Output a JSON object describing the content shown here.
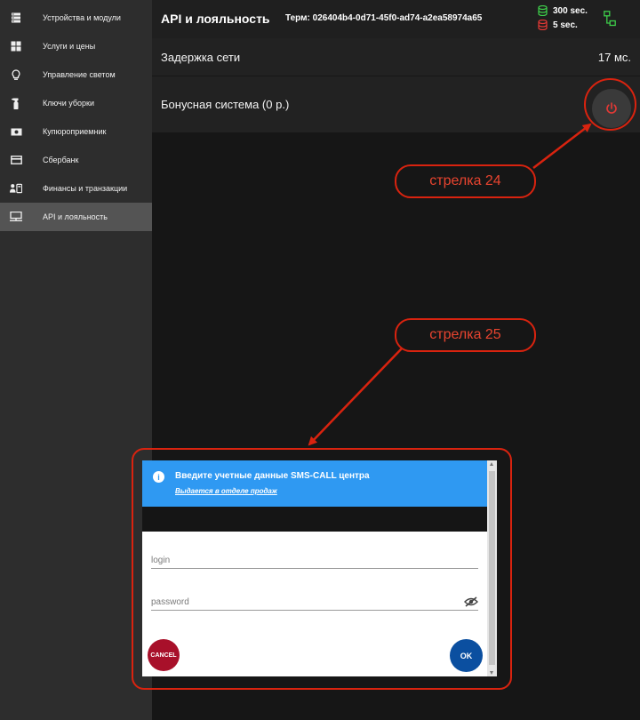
{
  "sidebar": {
    "items": [
      {
        "label": "Устройства и модули",
        "icon": "server-stack-icon"
      },
      {
        "label": "Услуги и цены",
        "icon": "grid-icon"
      },
      {
        "label": "Управление светом",
        "icon": "lightbulb-icon"
      },
      {
        "label": "Ключи уборки",
        "icon": "spray-bottle-icon"
      },
      {
        "label": "Купюроприемник",
        "icon": "banknote-icon"
      },
      {
        "label": "Сбербанк",
        "icon": "credit-card-icon"
      },
      {
        "label": "Финансы и транзакции",
        "icon": "finance-icon"
      },
      {
        "label": "API и лояльность",
        "icon": "monitor-network-icon",
        "active": true
      }
    ]
  },
  "header": {
    "title": "API и лояльность",
    "terminal": "Терм: 026404b4-0d71-45f0-ad74-a2ea58974a65",
    "status_green": "300 sec.",
    "status_red": "5 sec."
  },
  "network_row": {
    "label": "Задержка сети",
    "value": "17 мс."
  },
  "bonus_row": {
    "label": "Бонусная система (0 р.)"
  },
  "annotations": {
    "arrow_24": "стрелка 24",
    "arrow_25": "стрелка 25"
  },
  "dialog": {
    "title": "Введите учетные данные SMS-CALL центра",
    "subtitle": "Выдается в отделе продаж",
    "login_placeholder": "login",
    "password_placeholder": "password",
    "cancel_label": "CANCEL",
    "ok_label": "OK"
  },
  "colors": {
    "accent_blue": "#2f99f2",
    "cancel_red": "#a8102a",
    "ok_blue": "#0b4fa0",
    "power_red": "#e53935",
    "status_green": "#3ecf4a",
    "annotation_red": "#d9230f"
  }
}
